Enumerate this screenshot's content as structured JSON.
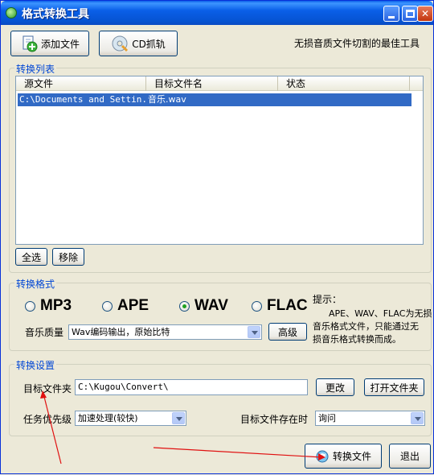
{
  "window": {
    "title": "格式转换工具"
  },
  "toolbar": {
    "add_file_label": "添加文件",
    "cd_rip_label": "CD抓轨",
    "slogan": "无损音质文件切割的最佳工具"
  },
  "convert_list": {
    "group_title": "转换列表",
    "columns": [
      "源文件",
      "目标文件名",
      "状态"
    ],
    "rows": [
      {
        "source": "C:\\Documents and Settin...",
        "target": "音乐.wav",
        "status": ""
      }
    ],
    "select_all_label": "全选",
    "remove_label": "移除"
  },
  "format": {
    "group_title": "转换格式",
    "options": [
      "MP3",
      "APE",
      "WAV",
      "FLAC"
    ],
    "selected": "WAV",
    "quality_label": "音乐质量",
    "quality_value": "Wav编码输出，原始比特",
    "advanced_label": "高级",
    "hint_title": "提示：",
    "hint_line1": "APE、WAV、FLAC为无损",
    "hint_line2": "音乐格式文件，只能通过无",
    "hint_line3": "损音乐格式转换而成。"
  },
  "settings": {
    "group_title": "转换设置",
    "target_folder_label": "目标文件夹",
    "target_folder_value": "C:\\Kugou\\Convert\\",
    "change_label": "更改",
    "open_folder_label": "打开文件夹",
    "priority_label": "任务优先级",
    "priority_value": "加速处理(较快)",
    "exists_label": "目标文件存在时",
    "exists_value": "询问"
  },
  "actions": {
    "convert_label": "转换文件",
    "exit_label": "退出"
  },
  "colors": {
    "title_bar": "#0a5fe8",
    "selection": "#316ac5",
    "group_title": "#0046d5",
    "annotation_arrow": "#e01010"
  }
}
